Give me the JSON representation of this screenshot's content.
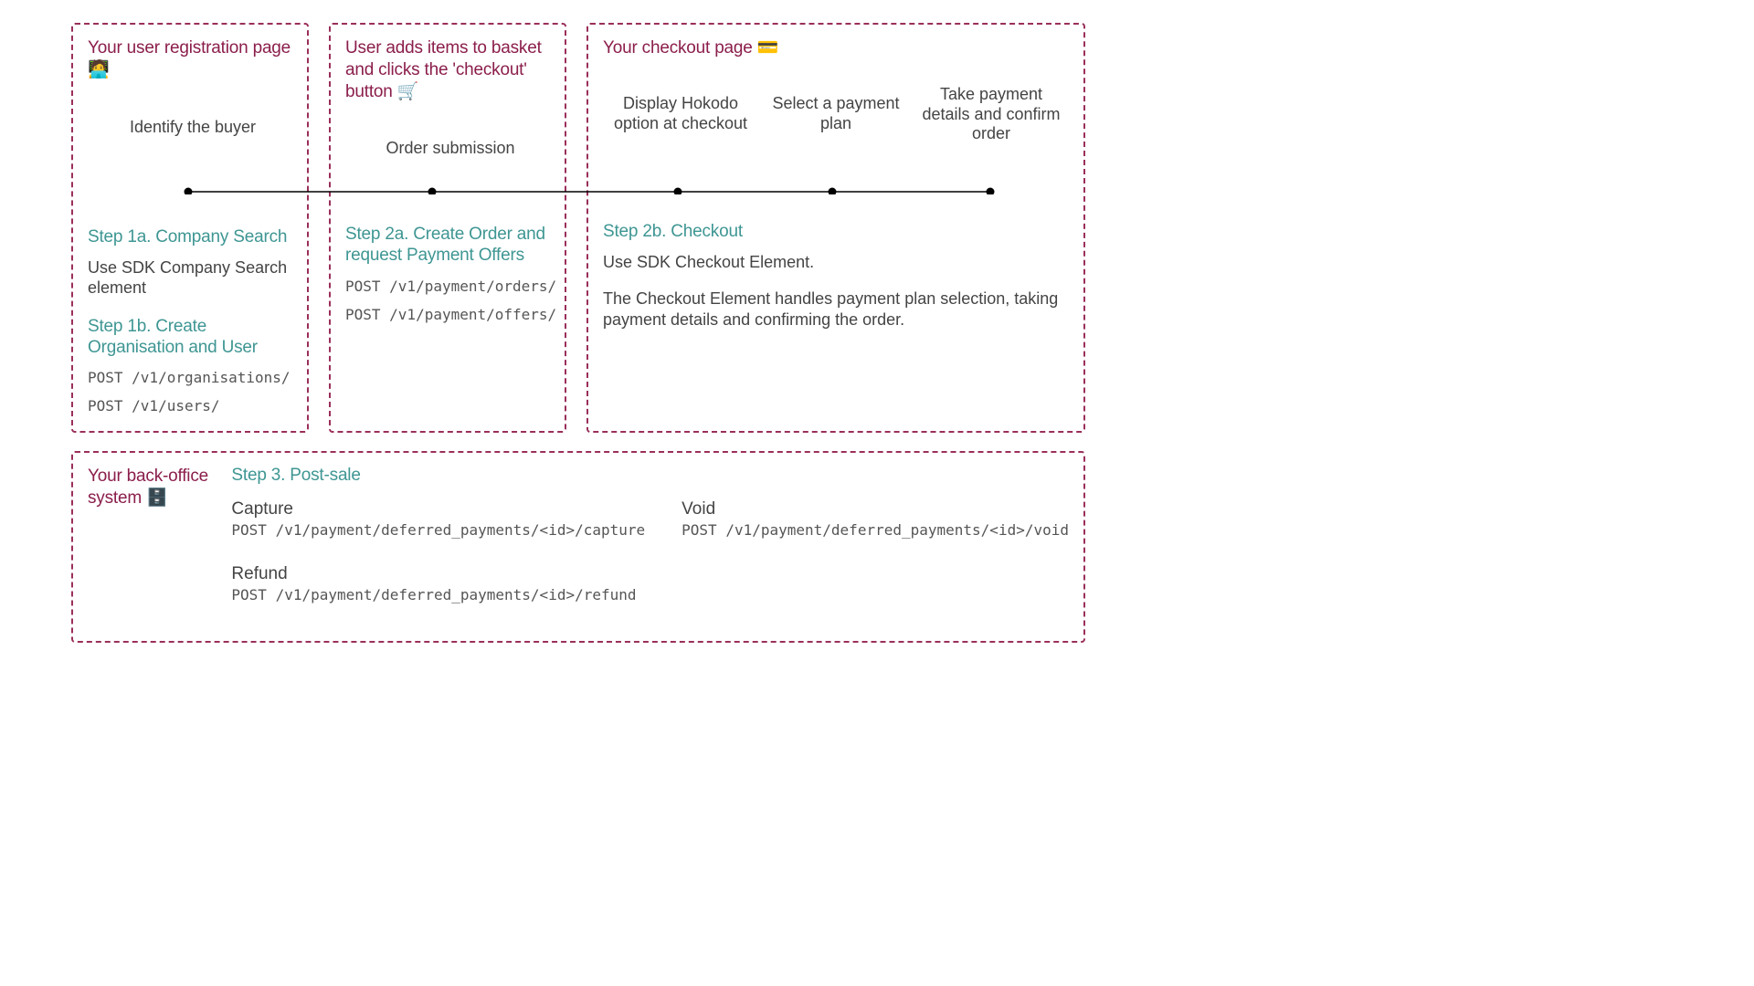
{
  "colors": {
    "accent_border": "#9a2f5a",
    "step_title": "#3e9693",
    "text": "#444444"
  },
  "phases": [
    {
      "context_title": "Your user registration page 🧑‍💻",
      "timeline_label": "Identify the buyer",
      "steps": [
        {
          "title": "Step 1a. Company Search",
          "body": "Use SDK Company Search element",
          "endpoints": []
        },
        {
          "title": "Step 1b. Create Organisation and User",
          "body": "",
          "endpoints": [
            "POST /v1/organisations/",
            "POST /v1/users/"
          ]
        }
      ]
    },
    {
      "context_title": "User adds items to basket and clicks the 'checkout' button 🛒",
      "timeline_label": "Order submission",
      "steps": [
        {
          "title": "Step 2a. Create Order and request Payment Offers",
          "body": "",
          "endpoints": [
            "POST /v1/payment/orders/",
            "POST /v1/payment/offers/"
          ]
        }
      ]
    },
    {
      "context_title": "Your checkout page 💳",
      "timeline_labels": [
        "Display Hokodo option at checkout",
        "Select a payment plan",
        "Take payment details and confirm order"
      ],
      "steps": [
        {
          "title": "Step 2b. Checkout",
          "body": "Use SDK Checkout Element.",
          "body2": "The Checkout Element handles payment plan selection, taking payment details and confirming the order.",
          "endpoints": []
        }
      ]
    }
  ],
  "post_sale": {
    "context_title": "Your back-office system 🗄️",
    "step_title": "Step 3. Post-sale",
    "actions": [
      {
        "name": "Capture",
        "endpoint": "POST /v1/payment/deferred_payments/<id>/capture"
      },
      {
        "name": "Void",
        "endpoint": "POST /v1/payment/deferred_payments/<id>/void"
      },
      {
        "name": "Refund",
        "endpoint": "POST /v1/payment/deferred_payments/<id>/refund"
      }
    ]
  }
}
